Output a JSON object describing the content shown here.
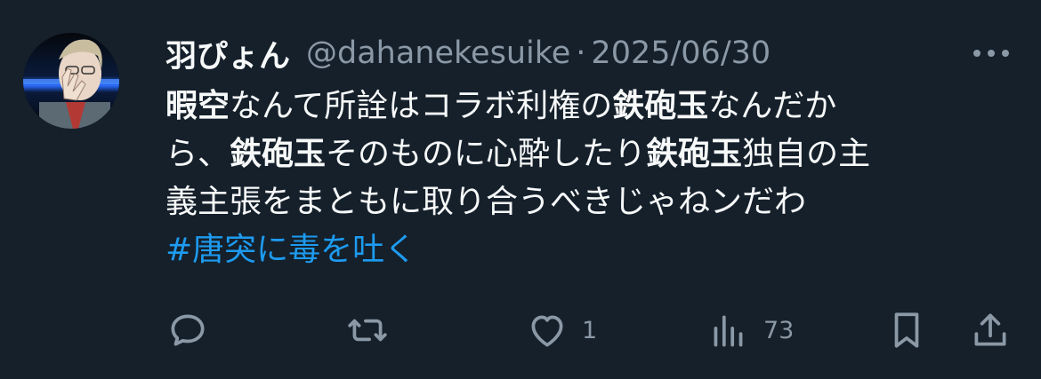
{
  "tweet": {
    "display_name": "羽ぴょん",
    "handle": "@dahanekesuike",
    "separator": "·",
    "date": "2025/06/30",
    "lines": [
      [
        {
          "text": "暇空",
          "bold": true
        },
        {
          "text": "なんて所詮はコラボ利権の",
          "bold": false
        },
        {
          "text": "鉄砲玉",
          "bold": true
        },
        {
          "text": "なんだか",
          "bold": false
        }
      ],
      [
        {
          "text": "ら、",
          "bold": false
        },
        {
          "text": "鉄砲玉",
          "bold": true
        },
        {
          "text": "そのものに心酔したり",
          "bold": false
        },
        {
          "text": "鉄砲玉",
          "bold": true
        },
        {
          "text": "独自の主",
          "bold": false
        }
      ],
      [
        {
          "text": "義主張をまともに取り合うべきじゃねンだわ",
          "bold": false
        }
      ]
    ],
    "hashtag": "#唐突に毒を吐く"
  },
  "actions": {
    "reply_icon": "reply-icon",
    "retweet_icon": "retweet-icon",
    "like_icon": "heart-icon",
    "like_count": "1",
    "views_icon": "views-icon",
    "views_count": "73",
    "bookmark_icon": "bookmark-icon",
    "share_icon": "share-icon"
  },
  "colors": {
    "background": "#15202b",
    "text": "#f7f9f9",
    "muted": "#8b98a5",
    "link": "#1d9bf0"
  }
}
